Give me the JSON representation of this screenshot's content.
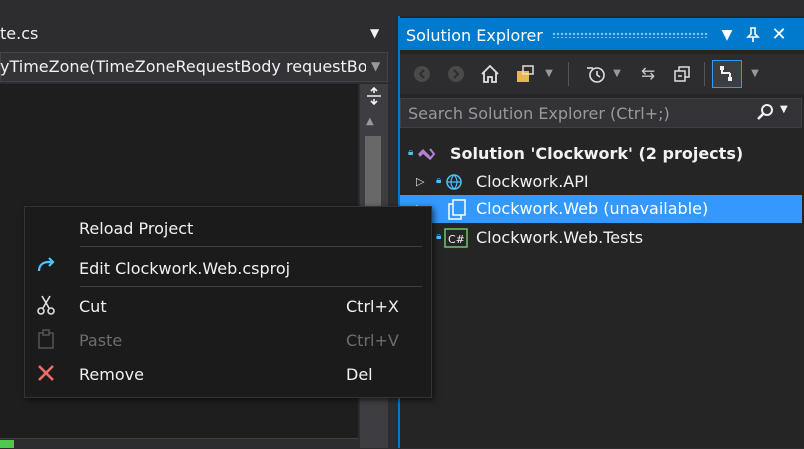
{
  "editor": {
    "tab_title": "te.cs",
    "nav_member": "yTimeZone(TimeZoneRequestBody requestBoc"
  },
  "solution_explorer": {
    "title": "Solution Explorer",
    "search_placeholder": "Search Solution Explorer (Ctrl+;)",
    "toolbar_icons": [
      "back-icon",
      "forward-icon",
      "home-icon",
      "switch-views-icon",
      "pending-changes-icon",
      "sync-icon",
      "collapse-all-icon",
      "track-active-item-icon"
    ],
    "tree": {
      "solution": "Solution 'Clockwork' (2 projects)",
      "items": [
        {
          "label": "Clockwork.API",
          "icon": "web-project-icon"
        },
        {
          "label": "Clockwork.Web (unavailable)",
          "icon": "unavailable-project-icon",
          "selected": true
        },
        {
          "label": "Clockwork.Web.Tests",
          "icon": "csharp-project-icon"
        }
      ]
    }
  },
  "context_menu": {
    "items": [
      {
        "label": "Reload Project",
        "shortcut": "",
        "icon": "",
        "enabled": true
      },
      {
        "label": "Edit Clockwork.Web.csproj",
        "shortcut": "",
        "icon": "edit-redo-arrow-icon",
        "enabled": true
      },
      {
        "label": "Cut",
        "shortcut": "Ctrl+X",
        "icon": "scissors-icon",
        "enabled": true
      },
      {
        "label": "Paste",
        "shortcut": "Ctrl+V",
        "icon": "clipboard-icon",
        "enabled": false
      },
      {
        "label": "Remove",
        "shortcut": "Del",
        "icon": "red-x-icon",
        "enabled": true
      }
    ]
  },
  "colors": {
    "accent": "#007acc",
    "selection": "#3399ff",
    "remove_icon": "#f16c6c"
  }
}
